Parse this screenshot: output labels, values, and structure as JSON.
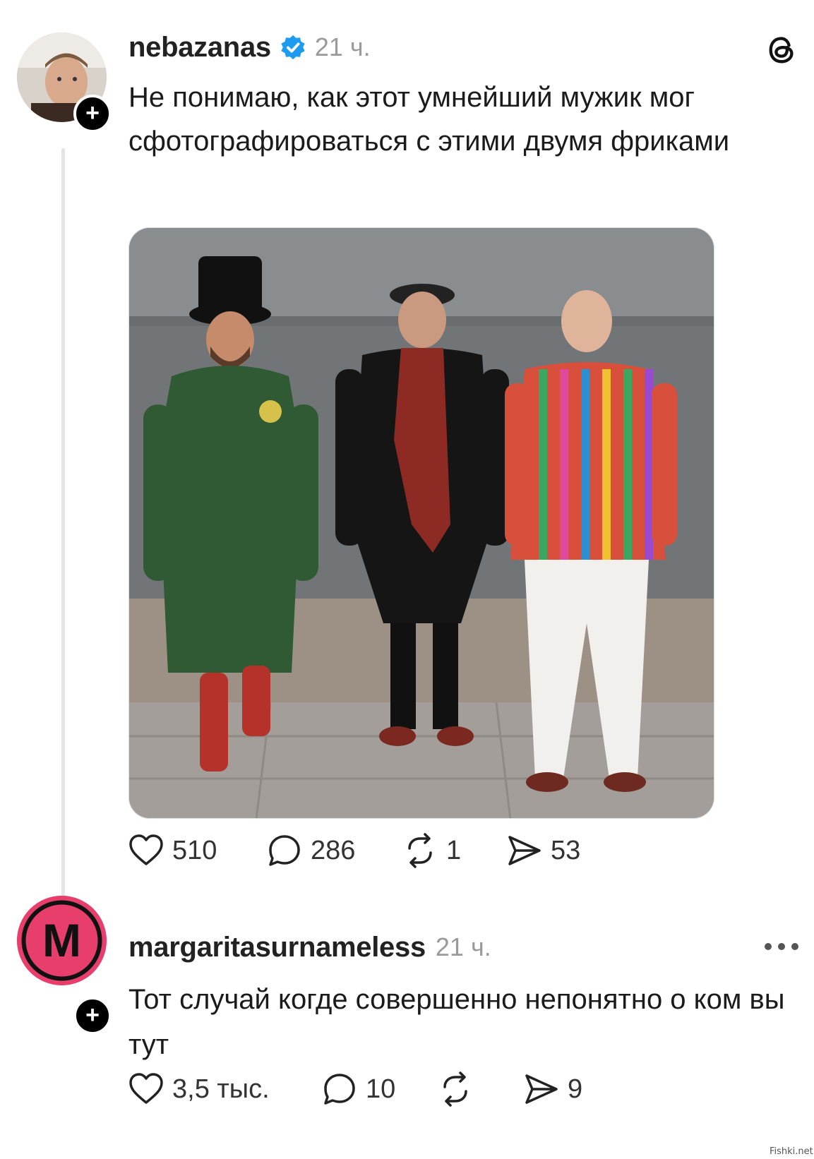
{
  "post": {
    "username": "nebazanas",
    "verified": true,
    "time": "21 ч.",
    "text": "Не понимаю, как этот умнейший мужик мог сфотографироваться с этими двумя фриками",
    "image": "photo of three men standing against a grey wall",
    "actions": {
      "likes": "510",
      "comments": "286",
      "reposts": "1",
      "shares": "53"
    }
  },
  "reply": {
    "username": "margaritasurnameless",
    "time": "21 ч.",
    "avatar_letter": "M",
    "text": "Тот случай когде совершенно непонятно о ком вы тут",
    "actions": {
      "likes": "3,5 тыс.",
      "comments": "10",
      "reposts": "",
      "shares": "9"
    }
  },
  "icons": [
    "plus-icon",
    "verified-icon",
    "threads-logo-icon",
    "heart-icon",
    "comment-icon",
    "repost-icon",
    "share-icon",
    "more-icon"
  ],
  "colors": {
    "verified": "#1d9bf0",
    "reply_avatar": "#e83e6c",
    "muted_text": "#9a9a9a"
  },
  "watermark": "Fishki.net"
}
